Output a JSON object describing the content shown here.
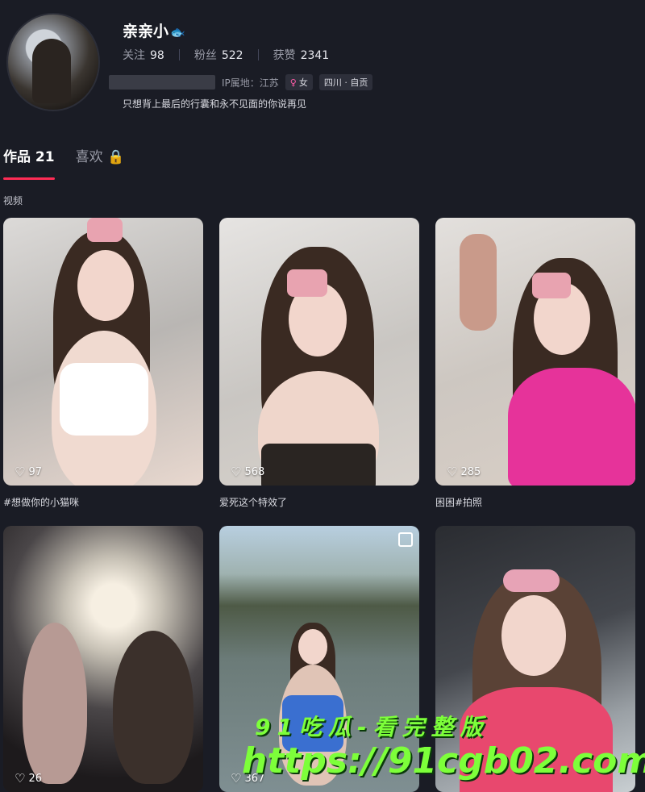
{
  "profile": {
    "name": "亲亲小",
    "badge_icon": "fish-icon",
    "stats": [
      {
        "label": "关注",
        "value": "98"
      },
      {
        "label": "粉丝",
        "value": "522"
      },
      {
        "label": "获赞",
        "value": "2341"
      }
    ],
    "ip": "IP属地：江苏",
    "gender": "女",
    "location_tag": "四川 · 自贡",
    "bio": "只想背上最后的行囊和永不见面的你说再见"
  },
  "tabs": {
    "works": "作品 21",
    "likes": "喜欢"
  },
  "section_label": "视频",
  "videos": [
    {
      "likes": "97",
      "caption": "#想做你的小猫咪"
    },
    {
      "likes": "568",
      "caption": "爱死这个特效了"
    },
    {
      "likes": "285",
      "caption": "困困#拍照"
    },
    {
      "likes": "26",
      "caption": ""
    },
    {
      "likes": "367",
      "caption": ""
    },
    {
      "likes": "",
      "caption": ""
    }
  ],
  "watermark": {
    "line1": "91吃瓜-看完整版",
    "line2": "https://91cgb02.com"
  },
  "colors": {
    "background": "#1a1c25",
    "accent": "#fe2c55",
    "watermark": "#7dff3a"
  }
}
